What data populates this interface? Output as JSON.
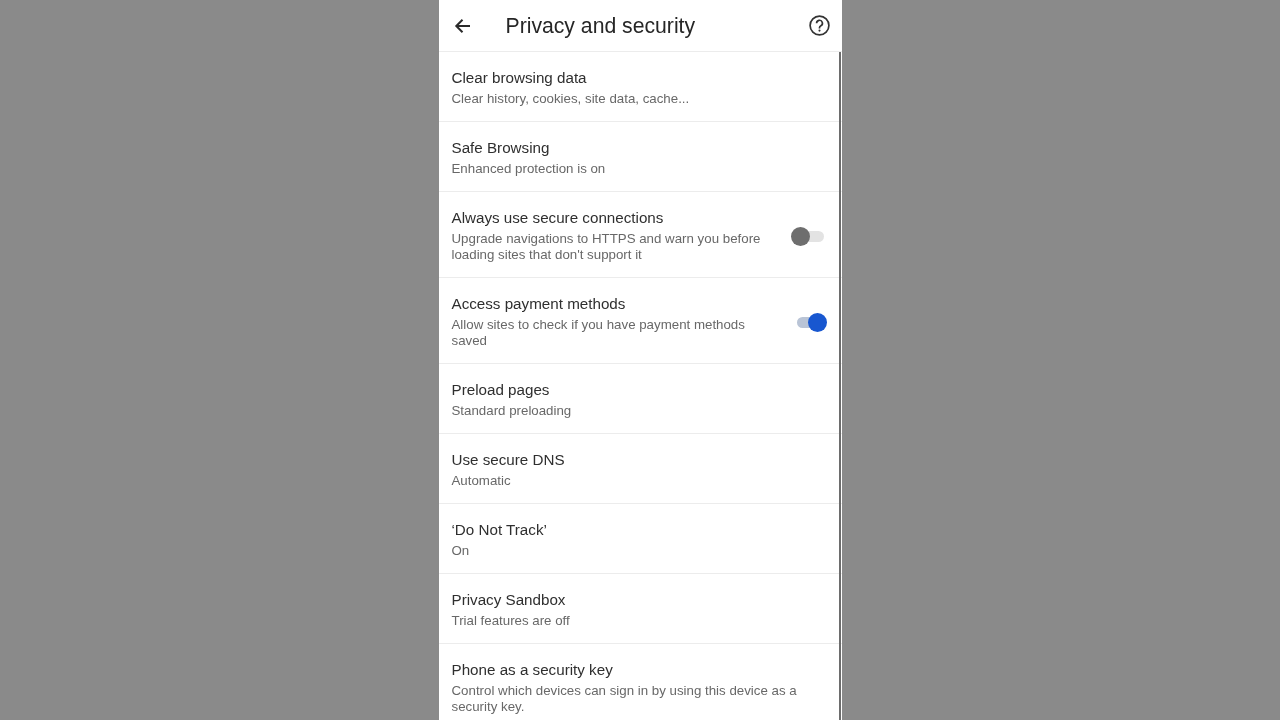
{
  "header": {
    "title": "Privacy and security"
  },
  "items": [
    {
      "kind": "nav",
      "title": "Clear browsing data",
      "subtitle": "Clear history, cookies, site data, cache..."
    },
    {
      "kind": "nav",
      "title": "Safe Browsing",
      "subtitle": "Enhanced protection is on"
    },
    {
      "kind": "toggle",
      "title": "Always use secure connections",
      "subtitle": "Upgrade navigations to HTTPS and warn you before loading sites that don't support it",
      "on": false
    },
    {
      "kind": "toggle",
      "title": "Access payment methods",
      "subtitle": "Allow sites to check if you have payment methods saved",
      "on": true
    },
    {
      "kind": "nav",
      "title": "Preload pages",
      "subtitle": "Standard preloading"
    },
    {
      "kind": "nav",
      "title": "Use secure DNS",
      "subtitle": "Automatic"
    },
    {
      "kind": "nav",
      "title": "‘Do Not Track’",
      "subtitle": "On"
    },
    {
      "kind": "nav",
      "title": "Privacy Sandbox",
      "subtitle": "Trial features are off"
    },
    {
      "kind": "nav",
      "title": "Phone as a security key",
      "subtitle": "Control which devices can sign in by using this device as a security key."
    }
  ]
}
